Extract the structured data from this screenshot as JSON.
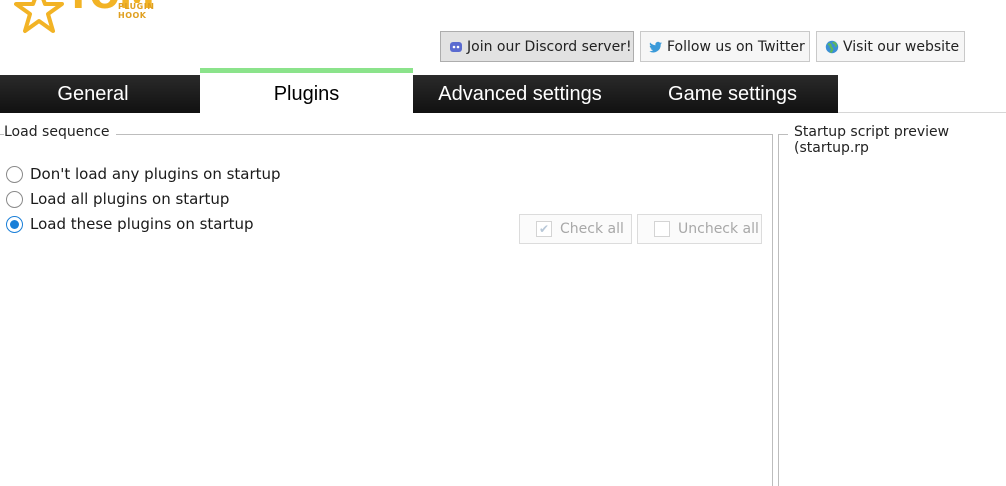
{
  "logo": {
    "text": "TOM",
    "subtext": "PLUGIN HOOK"
  },
  "links": {
    "discord": {
      "label": "Join our Discord server!",
      "icon": "discord-icon"
    },
    "twitter": {
      "label": "Follow us on Twitter",
      "icon": "twitter-bird-icon"
    },
    "website": {
      "label": "Visit our website",
      "icon": "globe-icon"
    }
  },
  "tabs": [
    {
      "label": "General"
    },
    {
      "label": "Plugins",
      "active": true
    },
    {
      "label": "Advanced settings"
    },
    {
      "label": "Game settings"
    }
  ],
  "load_sequence": {
    "title": "Load sequence",
    "options": [
      {
        "label": "Don't load any plugins on startup",
        "checked": false
      },
      {
        "label": "Load all plugins on startup",
        "checked": false
      },
      {
        "label": "Load these plugins on startup",
        "checked": true
      }
    ],
    "check_all_label": "Check all",
    "uncheck_all_label": "Uncheck all"
  },
  "startup_preview": {
    "title": "Startup script preview (startup.rp"
  },
  "colors": {
    "accent": "#1a7fd8",
    "tab_active_bar": "#8be38b",
    "logo": "#f2b325",
    "tabbar": "#1a1a1a"
  }
}
